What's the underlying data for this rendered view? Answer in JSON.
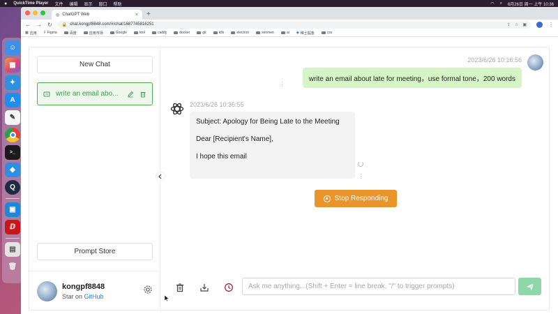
{
  "menubar": {
    "app_name": "QuickTime Player",
    "menus": [
      "文件",
      "编辑",
      "显示",
      "窗口",
      "帮助"
    ],
    "datetime": "6月26日 周一 上午 10:36"
  },
  "browser": {
    "tab_title": "ChatGPT Web",
    "url": "chat.kongpf8848.com/#/chat/1687745816251",
    "bookmarks": [
      "应用",
      "Figma",
      "百度",
      "应用市场",
      "Google",
      "tool",
      "caddy",
      "docker",
      "git",
      "k8s",
      "electron",
      "xenmen",
      "ai",
      "稀土掘金",
      "css"
    ]
  },
  "sidebar": {
    "new_chat_label": "New Chat",
    "chat_items": [
      {
        "title": "write an email abo..."
      }
    ],
    "prompt_store_label": "Prompt Store",
    "user": {
      "name": "kongpf8848",
      "star_prefix": "Star on",
      "star_link": "GitHub"
    }
  },
  "chat": {
    "user_timestamp": "2023/6/26 10:16:56",
    "user_message": "write an email about late for meeting，use formal tone，200 words",
    "bot_timestamp": "2023/6/26 10:36:55",
    "bot_lines": [
      "Subject: Apology for Being Late to the Meeting",
      "Dear [Recipient's Name],",
      "I hope this email"
    ],
    "stop_label": "Stop Responding"
  },
  "composer": {
    "placeholder": "Ask me anything...(Shift + Enter = line break, \"/\" to trigger prompts)",
    "value": ""
  },
  "colors": {
    "accent_green": "#4caf50",
    "user_bubble": "#d6f5c6",
    "stop_orange": "#e9952c",
    "send_green": "#90d7a8",
    "github_link": "#2f7bd8"
  },
  "icons": [
    "apple-icon",
    "wifi-icon",
    "search-icon",
    "close-icon",
    "edit-icon",
    "trash-icon",
    "gear-icon",
    "chevron-left-icon",
    "openai-logo-icon",
    "stop-icon",
    "download-icon",
    "history-icon",
    "send-icon"
  ]
}
